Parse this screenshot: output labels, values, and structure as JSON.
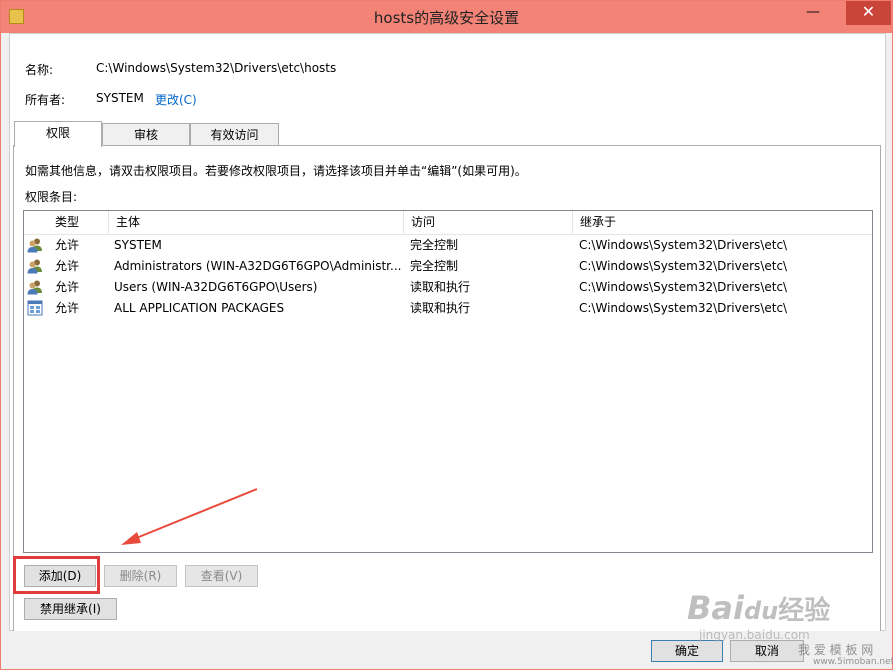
{
  "window": {
    "title": "hosts的高级安全设置",
    "minimize_glyph": "—",
    "close_glyph": "✕"
  },
  "info": {
    "name_label": "名称:",
    "name_value": "C:\\Windows\\System32\\Drivers\\etc\\hosts",
    "owner_label": "所有者:",
    "owner_value": "SYSTEM",
    "change_link": "更改(C)"
  },
  "tabs": [
    {
      "label": "权限",
      "active": true
    },
    {
      "label": "审核",
      "active": false
    },
    {
      "label": "有效访问",
      "active": false
    }
  ],
  "instructions": "如需其他信息，请双击权限项目。若要修改权限项目，请选择该项目并单击“编辑”(如果可用)。",
  "entries_label": "权限条目:",
  "table": {
    "headers": [
      "类型",
      "主体",
      "访问",
      "继承于"
    ],
    "rows": [
      {
        "icon": "users-icon",
        "type": "允许",
        "principal": "SYSTEM",
        "access": "完全控制",
        "inherited": "C:\\Windows\\System32\\Drivers\\etc\\"
      },
      {
        "icon": "users-icon",
        "type": "允许",
        "principal": "Administrators (WIN-A32DG6T6GPO\\Administr...",
        "access": "完全控制",
        "inherited": "C:\\Windows\\System32\\Drivers\\etc\\"
      },
      {
        "icon": "users-icon",
        "type": "允许",
        "principal": "Users (WIN-A32DG6T6GPO\\Users)",
        "access": "读取和执行",
        "inherited": "C:\\Windows\\System32\\Drivers\\etc\\"
      },
      {
        "icon": "app-packages-icon",
        "type": "允许",
        "principal": "ALL APPLICATION PACKAGES",
        "access": "读取和执行",
        "inherited": "C:\\Windows\\System32\\Drivers\\etc\\"
      }
    ]
  },
  "buttons": {
    "add": "添加(D)",
    "remove": "删除(R)",
    "view": "查看(V)",
    "disable_inheritance": "禁用继承(I)",
    "ok": "确定",
    "cancel": "取消"
  },
  "colors": {
    "titlebar": "#f48377",
    "highlight": "#e13c3c",
    "arrow": "#e84a3c",
    "link": "#0066cc"
  },
  "watermark": {
    "brand": "Bai",
    "paw": "du",
    "cn": "经验",
    "site": "jingyan.baidu.com",
    "corner_cn": "我 爱 模 板 网",
    "corner_url": "www.5imoban.net"
  }
}
